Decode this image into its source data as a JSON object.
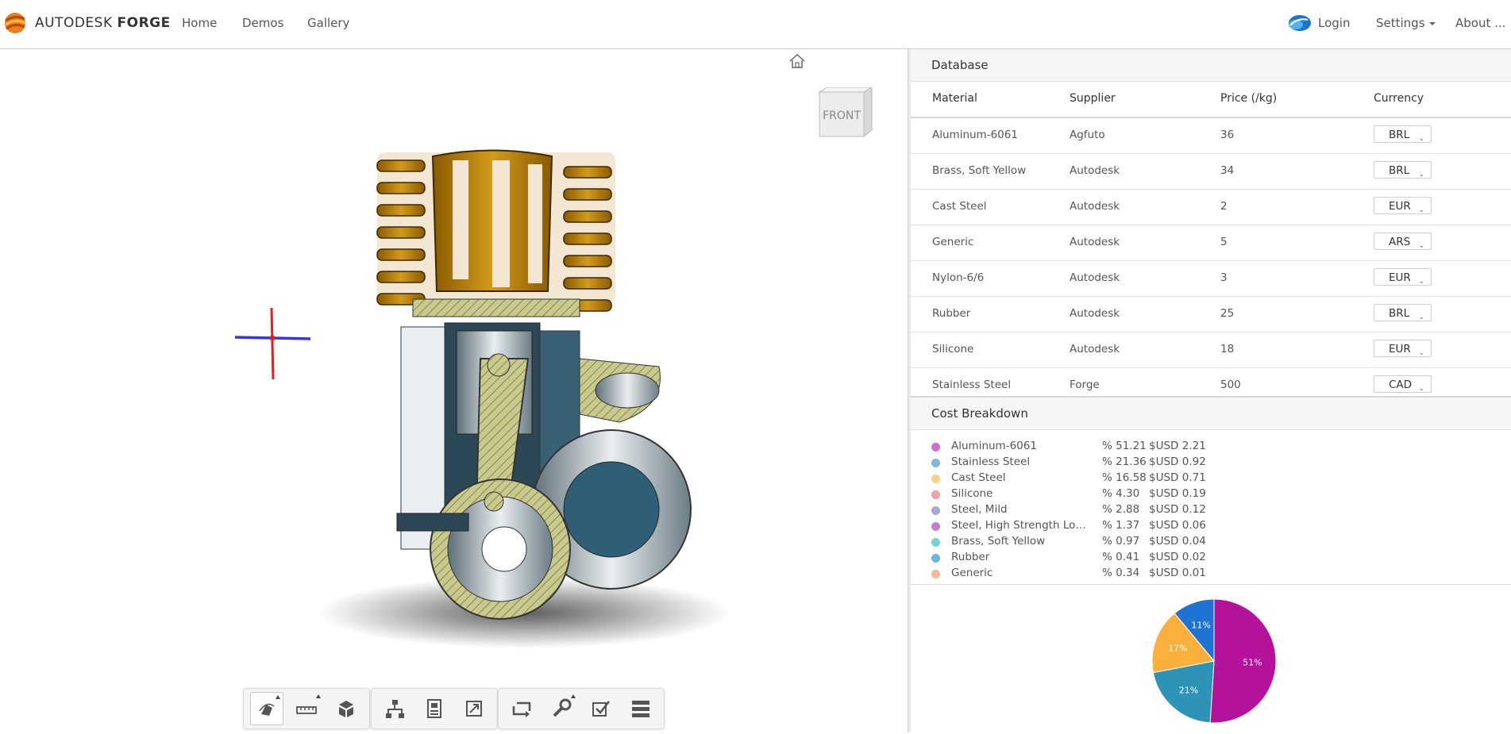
{
  "navbar": {
    "brand_light": "AUTODESK",
    "brand_bold": "FORGE",
    "links": [
      "Home",
      "Demos",
      "Gallery"
    ],
    "login_label": "Login",
    "settings_label": "Settings",
    "about_label": "About ..."
  },
  "viewer": {
    "viewcube_face": "FRONT",
    "toolbar_icons": [
      "orbit-icon",
      "measure-icon",
      "explode-icon",
      "model-browser-icon",
      "properties-icon",
      "fullscreen-icon",
      "section-icon",
      "settings-wrench-icon",
      "checklist-icon",
      "layers-icon"
    ]
  },
  "database": {
    "title": "Database",
    "columns": [
      "Material",
      "Supplier",
      "Price (/kg)",
      "Currency"
    ],
    "rows": [
      {
        "material": "Aluminum-6061",
        "supplier": "Agfuto",
        "price": "36",
        "currency": "BRL"
      },
      {
        "material": "Brass, Soft Yellow",
        "supplier": "Autodesk",
        "price": "34",
        "currency": "BRL"
      },
      {
        "material": "Cast Steel",
        "supplier": "Autodesk",
        "price": "2",
        "currency": "EUR"
      },
      {
        "material": "Generic",
        "supplier": "Autodesk",
        "price": "5",
        "currency": "ARS"
      },
      {
        "material": "Nylon-6/6",
        "supplier": "Autodesk",
        "price": "3",
        "currency": "EUR"
      },
      {
        "material": "Rubber",
        "supplier": "Autodesk",
        "price": "25",
        "currency": "BRL"
      },
      {
        "material": "Silicone",
        "supplier": "Autodesk",
        "price": "18",
        "currency": "EUR"
      },
      {
        "material": "Stainless Steel",
        "supplier": "Forge",
        "price": "500",
        "currency": "CAD"
      }
    ]
  },
  "cost": {
    "title": "Cost Breakdown",
    "items": [
      {
        "name": "Aluminum-6061",
        "pct": "% 51.21",
        "usd": "$USD 2.21",
        "color": "#d46bd0"
      },
      {
        "name": "Stainless Steel",
        "pct": "% 21.36",
        "usd": "$USD 0.92",
        "color": "#7fb8e0"
      },
      {
        "name": "Cast Steel",
        "pct": "% 16.58",
        "usd": "$USD 0.71",
        "color": "#fbcf83"
      },
      {
        "name": "Silicone",
        "pct": "% 4.30",
        "usd": "$USD 0.19",
        "color": "#f2a0a6"
      },
      {
        "name": "Steel, Mild",
        "pct": "% 2.88",
        "usd": "$USD 0.12",
        "color": "#a7a8d8"
      },
      {
        "name": "Steel, High Strength Low ...",
        "pct": "% 1.37",
        "usd": "$USD 0.06",
        "color": "#c37ed0"
      },
      {
        "name": "Brass, Soft Yellow",
        "pct": "% 0.97",
        "usd": "$USD 0.04",
        "color": "#6fd3d8"
      },
      {
        "name": "Rubber",
        "pct": "% 0.41",
        "usd": "$USD 0.02",
        "color": "#66b7e8"
      },
      {
        "name": "Generic",
        "pct": "% 0.34",
        "usd": "$USD 0.01",
        "color": "#f8b79b"
      }
    ]
  },
  "chart_data": {
    "type": "pie",
    "title": "",
    "slices": [
      {
        "label": "51%",
        "value": 51,
        "color": "#b5129b"
      },
      {
        "label": "21%",
        "value": 21,
        "color": "#2d94b8"
      },
      {
        "label": "17%",
        "value": 17,
        "color": "#fbb03b"
      },
      {
        "label": "11%",
        "value": 11,
        "color": "#1f73d3"
      }
    ]
  }
}
